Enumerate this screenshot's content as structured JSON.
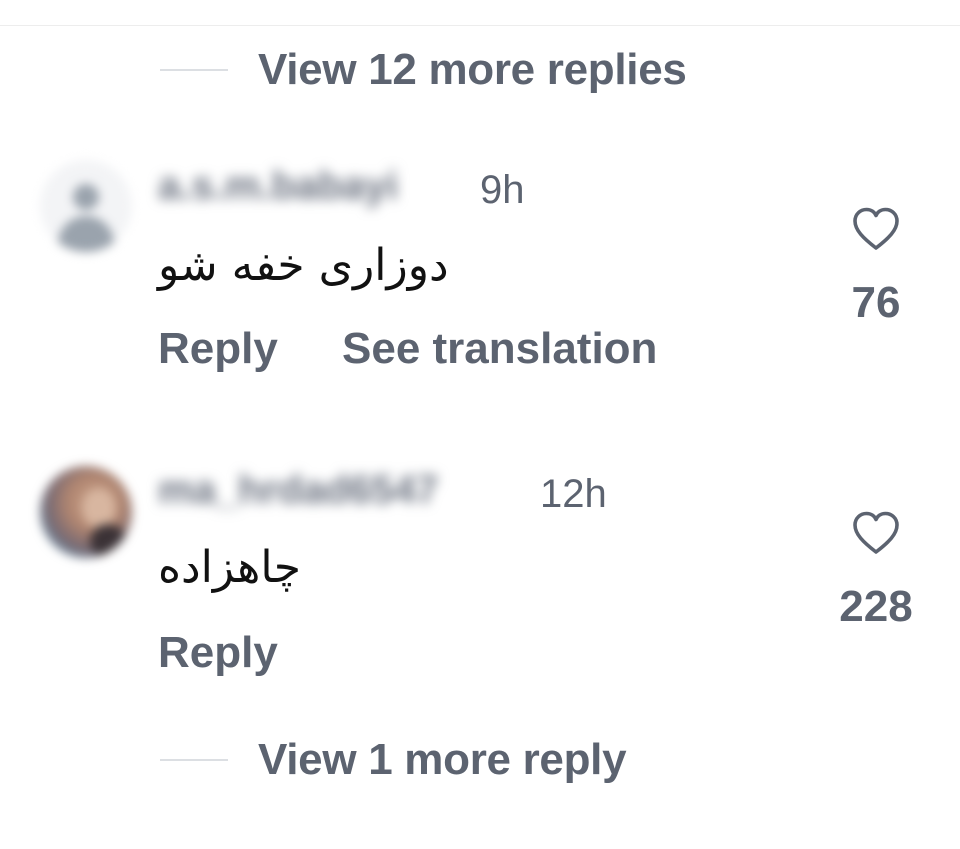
{
  "top_replies": {
    "label": "View 12 more replies"
  },
  "comments": [
    {
      "username": "a.s.m.babayi",
      "time": "9h",
      "text": "دوزاری خفه شو",
      "reply_label": "Reply",
      "translate_label": "See translation",
      "likes": "76",
      "like_icon": "heart-outline-icon"
    },
    {
      "username": "ma_hrdad6547",
      "time": "12h",
      "text": "چاهزاده",
      "reply_label": "Reply",
      "likes": "228",
      "like_icon": "heart-outline-icon"
    }
  ],
  "bottom_replies": {
    "label": "View 1 more reply"
  },
  "colors": {
    "secondary_text": "#5c6370",
    "primary_text": "#111111",
    "divider": "#dcdfe3"
  }
}
